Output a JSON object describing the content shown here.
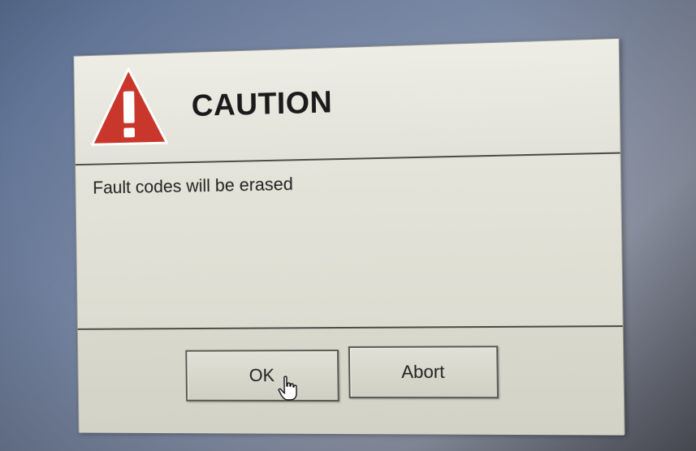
{
  "dialog": {
    "title": "CAUTION",
    "message": "Fault codes will be erased",
    "icon": "warning-triangle-icon",
    "buttons": {
      "ok_label": "OK",
      "abort_label": "Abort"
    }
  },
  "colors": {
    "warning_red": "#c9372c",
    "dialog_bg": "#e6e6dd",
    "separator": "#4c4c48"
  },
  "cursor": {
    "icon": "hand-pointer-icon"
  }
}
